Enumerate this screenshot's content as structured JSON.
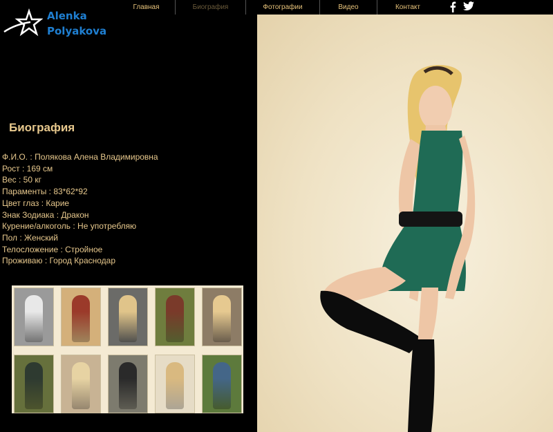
{
  "brand": {
    "line1": "Alenka",
    "line2": "Polyakova",
    "color": "#1f7fd1"
  },
  "nav": {
    "items": [
      {
        "label": "Главная",
        "active": false
      },
      {
        "label": "Биография",
        "active": true
      },
      {
        "label": "Фотографии",
        "active": false
      },
      {
        "label": "Видео",
        "active": false
      },
      {
        "label": "Контакт",
        "active": false
      }
    ],
    "social": [
      "facebook-icon",
      "twitter-icon"
    ]
  },
  "bio": {
    "title": "Биография",
    "items": [
      "Ф.И.О. : Полякова Алена Владимировна",
      "Рост : 169 см",
      "Вес : 50 кг",
      "Параменты : 83*62*92",
      "Цвет глаз : Карие",
      "Знак Зодиака : Дракон",
      "Курение/алкоголь : Не употребляю",
      "Пол : Женский",
      "Телосложение : Стройное",
      "Проживаю : Город Краснодар"
    ]
  },
  "gallery": {
    "thumbnails": [
      {
        "bg": "#9a9a9a",
        "tone": "#e8e8e8"
      },
      {
        "bg": "#d4b07a",
        "tone": "#9b3a2a"
      },
      {
        "bg": "#6b6b68",
        "tone": "#e0c48a"
      },
      {
        "bg": "#6f7d3e",
        "tone": "#7a3a2a"
      },
      {
        "bg": "#8d7c66",
        "tone": "#e6c990"
      },
      {
        "bg": "#66703c",
        "tone": "#2e3a30"
      },
      {
        "bg": "#c8b394",
        "tone": "#e7d3a3"
      },
      {
        "bg": "#7d7b6e",
        "tone": "#2a2a2a"
      },
      {
        "bg": "#e6dcc6",
        "tone": "#d9b980"
      },
      {
        "bg": "#5d7a3c",
        "tone": "#446688"
      }
    ]
  },
  "colors": {
    "text": "#e7c88d",
    "background": "#000000",
    "gallery_frame": "#f4ead3"
  }
}
